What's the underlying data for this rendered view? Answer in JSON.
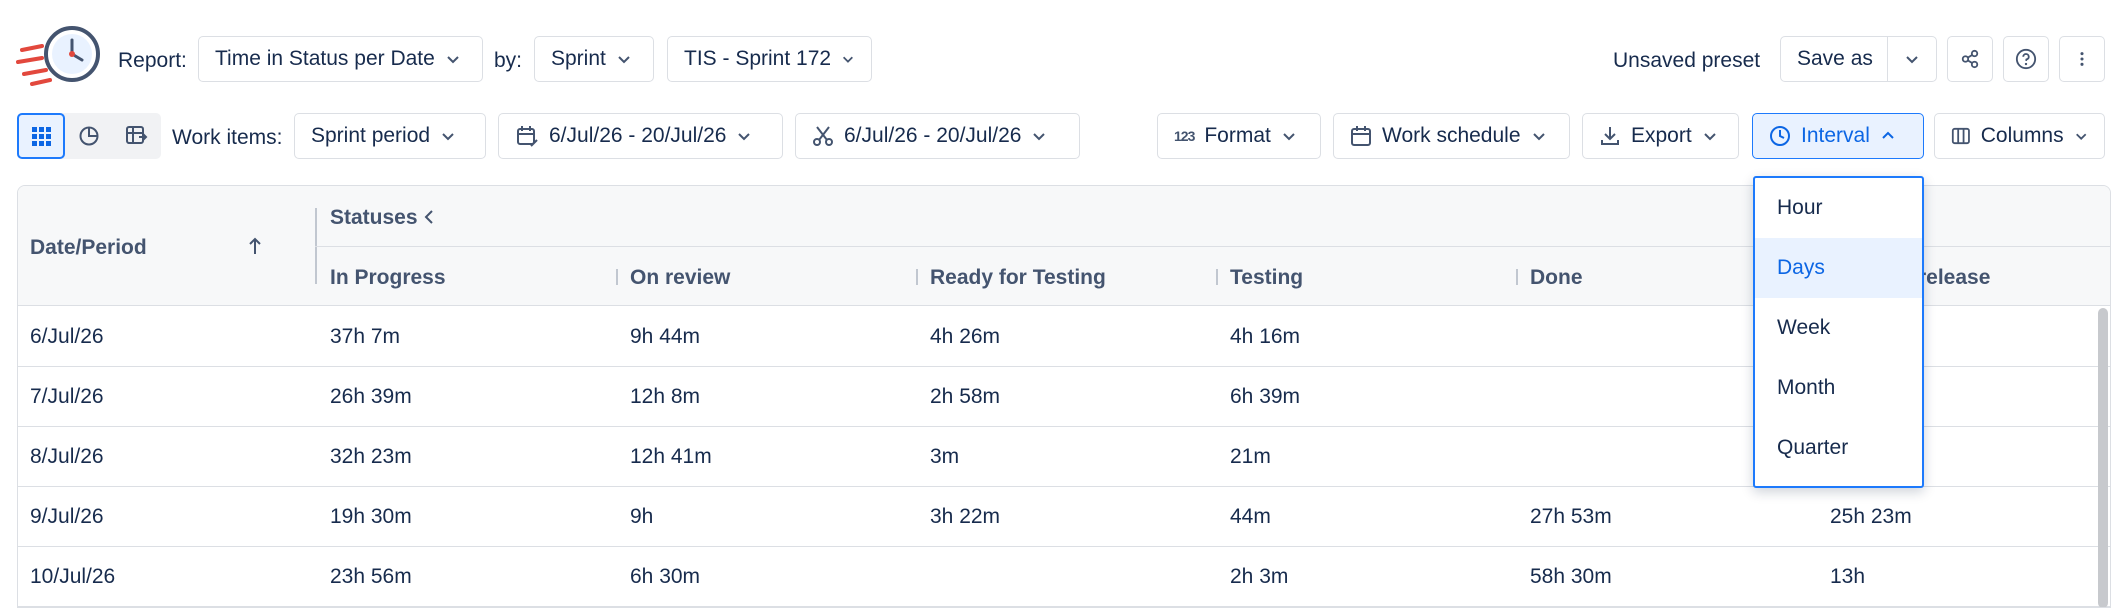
{
  "header": {
    "report_label": "Report:",
    "report_value": "Time in Status per Date",
    "by_label": "by:",
    "by_value": "Sprint",
    "sprint_value": "TIS - Sprint 172",
    "preset_status": "Unsaved preset",
    "save_as_label": "Save as"
  },
  "toolbar": {
    "work_items_label": "Work items:",
    "work_items_value": "Sprint period",
    "date_range": "6/Jul/26 - 20/Jul/26",
    "trim_range": "6/Jul/26 - 20/Jul/26",
    "format_label": "Format",
    "work_schedule_label": "Work schedule",
    "export_label": "Export",
    "interval_label": "Interval",
    "columns_label": "Columns"
  },
  "colors": {
    "accent": "#0c66e4",
    "accent_border": "#1d7afc",
    "selected_bg": "#e9f2ff"
  },
  "table": {
    "date_header": "Date/Period",
    "group_header": "Statuses",
    "columns": [
      "In Progress",
      "On review",
      "Ready for Testing",
      "Testing",
      "Done",
      "release"
    ],
    "rows": [
      {
        "date": "6/Jul/26",
        "values": [
          "37h 7m",
          "9h 44m",
          "4h 26m",
          "4h 16m",
          "",
          ""
        ]
      },
      {
        "date": "7/Jul/26",
        "values": [
          "26h 39m",
          "12h 8m",
          "2h 58m",
          "6h 39m",
          "",
          ""
        ]
      },
      {
        "date": "8/Jul/26",
        "values": [
          "32h 23m",
          "12h 41m",
          "3m",
          "21m",
          "",
          ""
        ]
      },
      {
        "date": "9/Jul/26",
        "values": [
          "19h 30m",
          "9h",
          "3h 22m",
          "44m",
          "27h 53m",
          "25h 23m"
        ]
      },
      {
        "date": "10/Jul/26",
        "values": [
          "23h 56m",
          "6h 30m",
          "",
          "2h 3m",
          "58h 30m",
          "13h"
        ]
      }
    ]
  },
  "interval_menu": {
    "options": [
      "Hour",
      "Days",
      "Week",
      "Month",
      "Quarter"
    ],
    "selected": "Days"
  }
}
